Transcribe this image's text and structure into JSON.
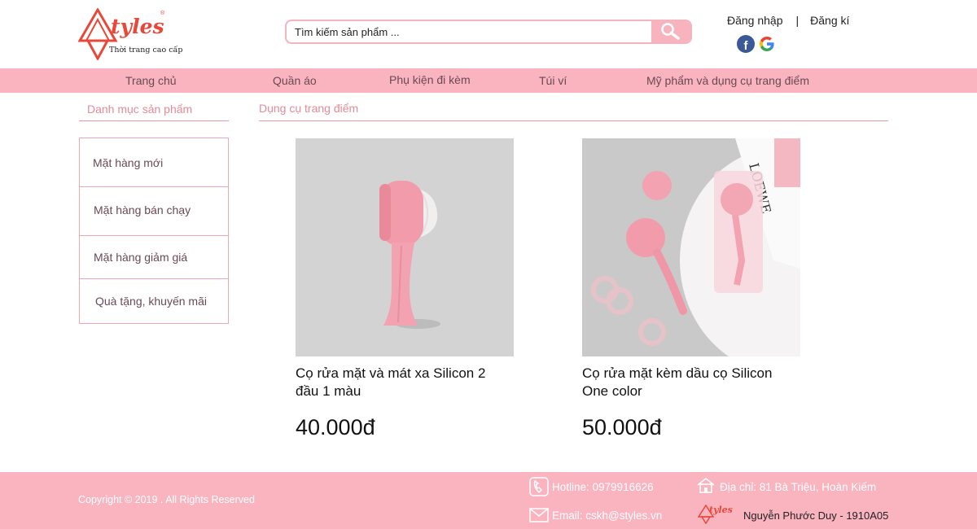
{
  "brand": {
    "name": "tyles",
    "registered": "®",
    "tagline": "Thời trang cao cấp",
    "accent_color": "#e8483a",
    "pink_color": "#f9b4c0"
  },
  "search": {
    "placeholder": "Tìm kiếm sản phẩm ...",
    "button_icon": "search-icon"
  },
  "auth": {
    "login": "Đăng nhập",
    "separator": "|",
    "register": "Đăng kí",
    "facebook_letter": "f"
  },
  "nav": {
    "items": [
      "Trang chủ",
      "Quần áo",
      "Phụ kiện đi kèm",
      "Túi ví",
      "Mỹ phẩm và dụng cụ trang điểm"
    ]
  },
  "sidebar": {
    "title": "Danh mục sản phẩm",
    "items": [
      "Mặt hàng mới",
      "Mặt hàng bán chạy",
      "Mặt hàng giảm giá",
      "Quà tặng, khuyến mãi"
    ]
  },
  "content": {
    "title": "Dụng cụ trang điểm",
    "products": [
      {
        "name": "Cọ rửa mặt và mát xa Silicon 2 đầu 1 màu",
        "price": "40.000đ"
      },
      {
        "name": "Cọ rửa mặt kèm dầu cọ Silicon One color",
        "price": "50.000đ"
      }
    ]
  },
  "footer": {
    "copyright": "Copyright © 2019 . All Rights Reserved",
    "hotline": "Hotline: 0979916626",
    "address": "Địa chỉ: 81 Bà Triệu, Hoàn Kiếm",
    "email": "Email: cskh@styles.vn",
    "author": "Nguyễn Phước Duy - 1910A05",
    "mini_logo_text": "tyles"
  }
}
